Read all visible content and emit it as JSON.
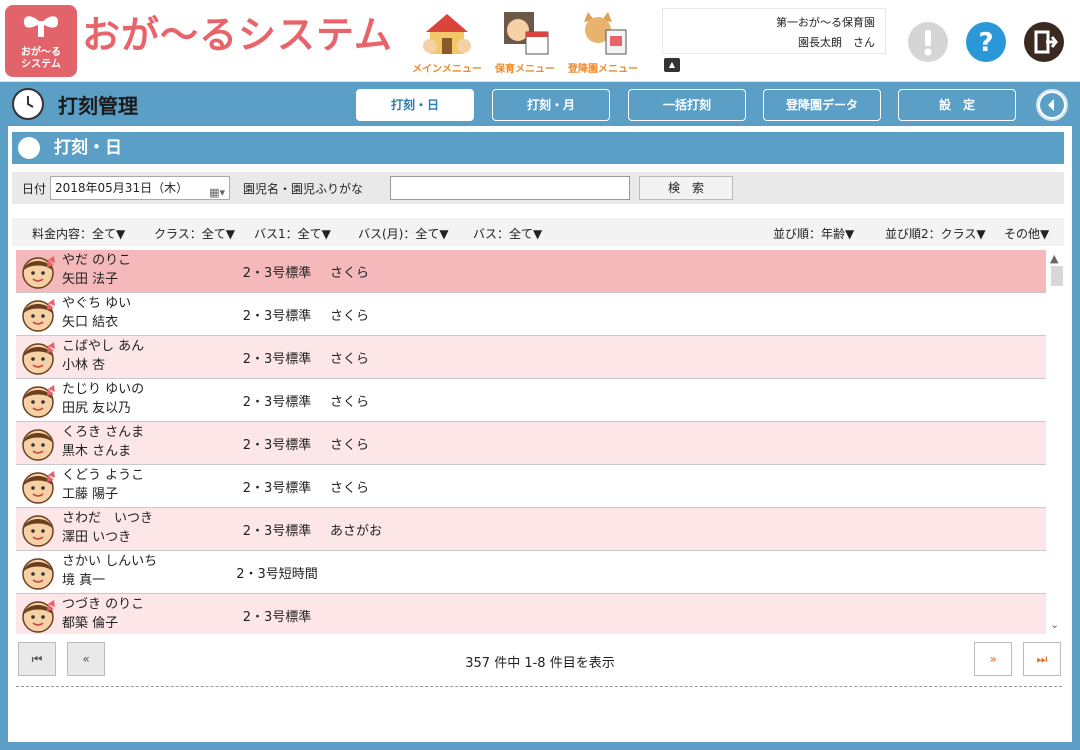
{
  "app": {
    "logo_text_line1": "おが〜る",
    "logo_text_line2": "システム",
    "title": "おが〜るシステム"
  },
  "menus": [
    {
      "label": "メインメニュー"
    },
    {
      "label": "保育メニュー"
    },
    {
      "label": "登降園メニュー"
    }
  ],
  "user": {
    "facility": "第一おが〜る保育園",
    "name": "園長太朗　さん"
  },
  "page": {
    "title": "打刻管理"
  },
  "tabs": [
    {
      "label": "打刻・日"
    },
    {
      "label": "打刻・月"
    },
    {
      "label": "一括打刻"
    },
    {
      "label": "登降園データ"
    },
    {
      "label": "設　定"
    }
  ],
  "section": {
    "title": "打刻・日"
  },
  "filter": {
    "date_label": "日付",
    "date_value": "2018年05月31日（木）",
    "name_label": "園児名・園児ふりがな",
    "search_value": "",
    "search_button": "検　索"
  },
  "sort": {
    "fee": "料金内容：全て▼",
    "class": "クラス：全て▼",
    "bus1": "バス1：全て▼",
    "bus_month": "バス(月)：全て▼",
    "bus": "バス：全て▼",
    "order1": "並び順：年齢▼",
    "order2": "並び順2：クラス▼",
    "other": "その他▼"
  },
  "rows": [
    {
      "kana": "やだ のりこ",
      "kanji": "矢田 法子",
      "type": "2・3号標準",
      "cls": "さくら",
      "gender": "girl"
    },
    {
      "kana": "やぐち ゆい",
      "kanji": "矢口 結衣",
      "type": "2・3号標準",
      "cls": "さくら",
      "gender": "girl"
    },
    {
      "kana": "こばやし あん",
      "kanji": "小林 杏",
      "type": "2・3号標準",
      "cls": "さくら",
      "gender": "girl"
    },
    {
      "kana": "たじり ゆいの",
      "kanji": "田尻 友以乃",
      "type": "2・3号標準",
      "cls": "さくら",
      "gender": "girl"
    },
    {
      "kana": "くろき さんま",
      "kanji": "黒木 さんま",
      "type": "2・3号標準",
      "cls": "さくら",
      "gender": "boy"
    },
    {
      "kana": "くどう ようこ",
      "kanji": "工藤 陽子",
      "type": "2・3号標準",
      "cls": "さくら",
      "gender": "girl"
    },
    {
      "kana": "さわだ　いつき",
      "kanji": "澤田 いつき",
      "type": "2・3号標準",
      "cls": "あさがお",
      "gender": "boy"
    },
    {
      "kana": "さかい しんいち",
      "kanji": "境 真一",
      "type": "2・3号短時間",
      "cls": "",
      "gender": "boy"
    },
    {
      "kana": "つづき のりこ",
      "kanji": "都築 倫子",
      "type": "2・3号標準",
      "cls": "",
      "gender": "girl"
    }
  ],
  "pager": {
    "count_text": "357 件中 1-8 件目を表示"
  },
  "colors": {
    "brand": "#e8646b",
    "accent": "#5b9fc7",
    "row_pink": "#fde6e7",
    "row_selected": "#f5b9bb"
  }
}
